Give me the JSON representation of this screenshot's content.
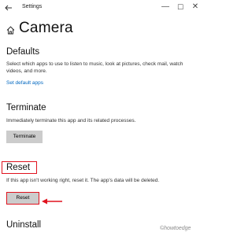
{
  "window": {
    "title": "Settings",
    "controls": {
      "minimize": "—",
      "maximize": "☐",
      "close": "✕"
    }
  },
  "page": {
    "title": "Camera"
  },
  "defaults": {
    "heading": "Defaults",
    "description": "Select which apps to use to listen to music, look at pictures, check mail, watch videos, and more.",
    "link": "Set default apps"
  },
  "terminate": {
    "heading": "Terminate",
    "description": "Immediately terminate this app and its related processes.",
    "button": "Terminate"
  },
  "reset": {
    "heading": "Reset",
    "description": "If this app isn't working right, reset it. The app's data will be deleted.",
    "button": "Reset"
  },
  "uninstall": {
    "heading": "Uninstall"
  },
  "watermark": "©howtoedge",
  "colors": {
    "highlight": "#e0121e",
    "link": "#0067c0",
    "button": "#cccccc"
  }
}
